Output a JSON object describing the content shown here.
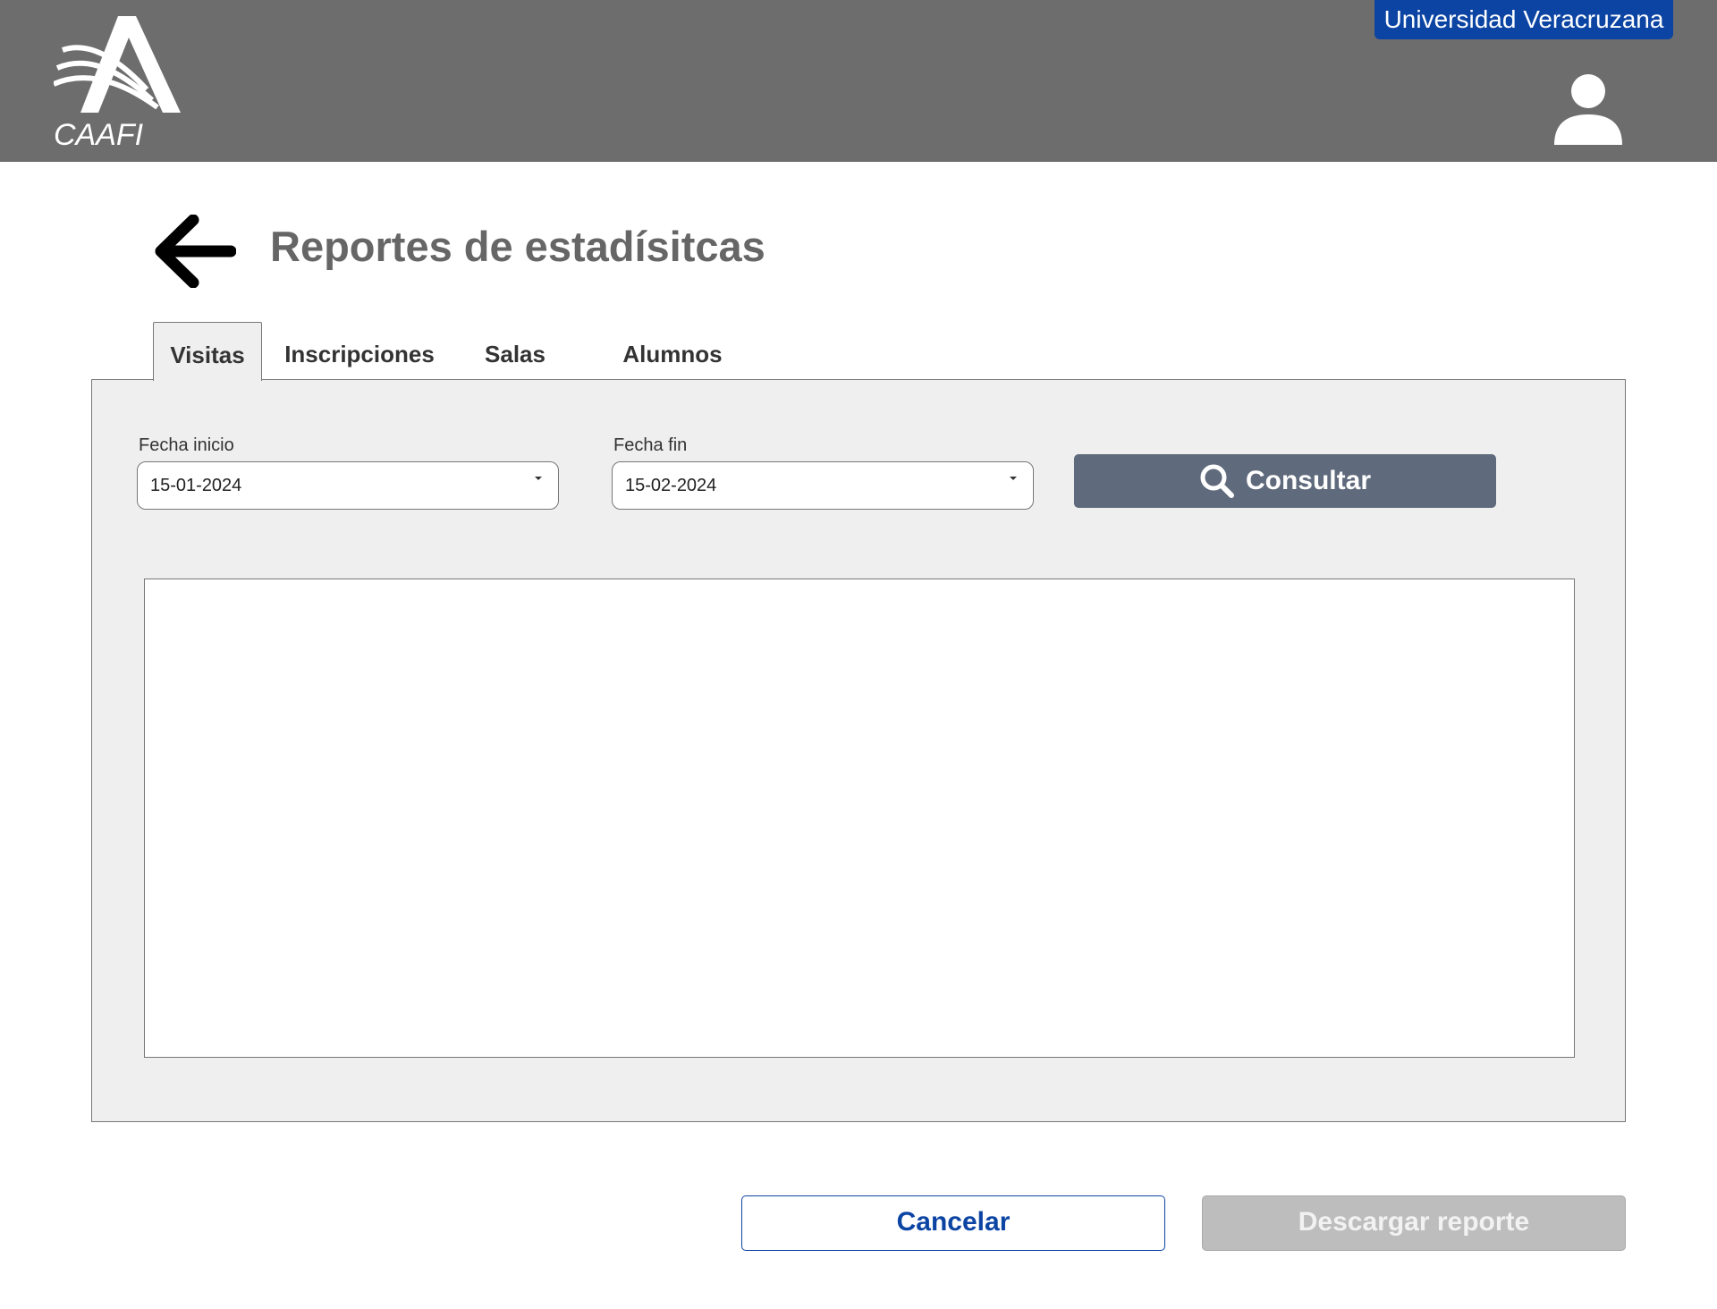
{
  "header": {
    "logo_text": "CAAFI",
    "institution": "Universidad Veracruzana",
    "user_icon": "user-icon"
  },
  "page": {
    "title": "Reportes de estadísitcas",
    "back_icon": "arrow-left-icon"
  },
  "tabs": [
    {
      "label": "Visitas",
      "active": true
    },
    {
      "label": "Inscripciones",
      "active": false
    },
    {
      "label": "Salas",
      "active": false
    },
    {
      "label": "Alumnos",
      "active": false
    }
  ],
  "filters": {
    "start_label": "Fecha inicio",
    "start_value": "15-01-2024",
    "end_label": "Fecha fin",
    "end_value": "15-02-2024",
    "consult_label": "Consultar",
    "consult_icon": "search-icon"
  },
  "footer": {
    "cancel_label": "Cancelar",
    "download_label": "Descargar reporte"
  },
  "colors": {
    "header_bg": "#6d6d6d",
    "brand_blue": "#0c44a3",
    "consult_bg": "#5f6a7c",
    "panel_bg": "#efefef",
    "disabled_bg": "#bdbdbd"
  }
}
